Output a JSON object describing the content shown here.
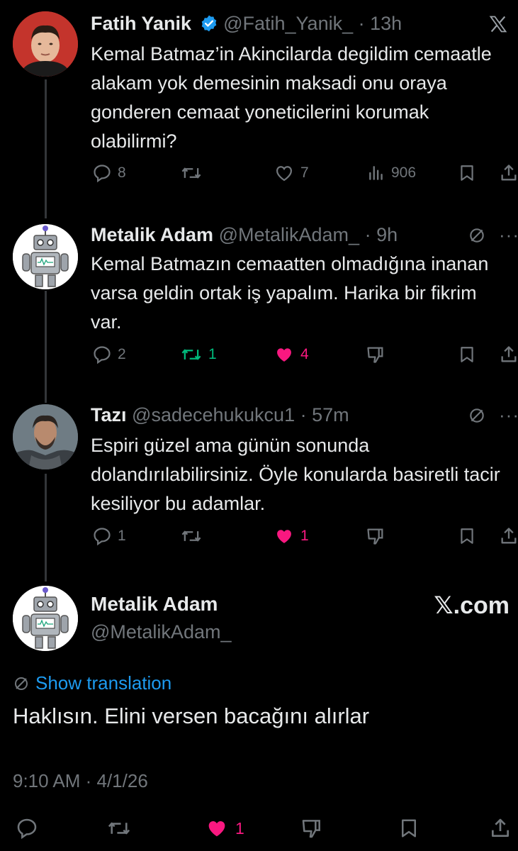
{
  "tweets": [
    {
      "name": "Fatih Yanik",
      "verified": true,
      "handle": "@Fatih_Yanik_",
      "time": "· 13h",
      "text": "Kemal Batmaz’in Akincilarda degildim cemaatle alakam yok demesinin maksadi onu oraya gonderen cemaat yoneticilerini korumak olabilirmi?",
      "replies": "8",
      "reposts": "",
      "likes": "7",
      "views": "906"
    },
    {
      "name": "Metalik Adam",
      "handle": "@MetalikAdam_",
      "time": "· 9h",
      "text": "Kemal Batmazın cemaatten olmadığına inanan varsa geldin ortak iş yapalım. Harika bir fikrim var.",
      "replies": "2",
      "reposts": "1",
      "likes": "4"
    },
    {
      "name": "Tazı",
      "handle": "@sadecehukukcu1",
      "time": "· 57m",
      "text": "Espiri güzel ama günün sonunda dolandırılabilirsiniz. Öyle konularda basiretli tacir kesiliyor bu adamlar.",
      "replies": "1",
      "reposts": "",
      "likes": "1"
    }
  ],
  "main": {
    "name": "Metalik Adam",
    "handle": "@MetalikAdam_",
    "brand": "𝕏.com",
    "show_translation": "Show translation",
    "text": "Haklısın. Elini versen bacağını alırlar",
    "timestamp": "9:10 AM · 4/1/26",
    "likes": "1"
  },
  "colors": {
    "background": "#000000",
    "text": "#e7e9ea",
    "muted": "#71767b",
    "link": "#1d9bf0",
    "like": "#f91880",
    "repost": "#00ba7c",
    "verified": "#1d9bf0"
  }
}
